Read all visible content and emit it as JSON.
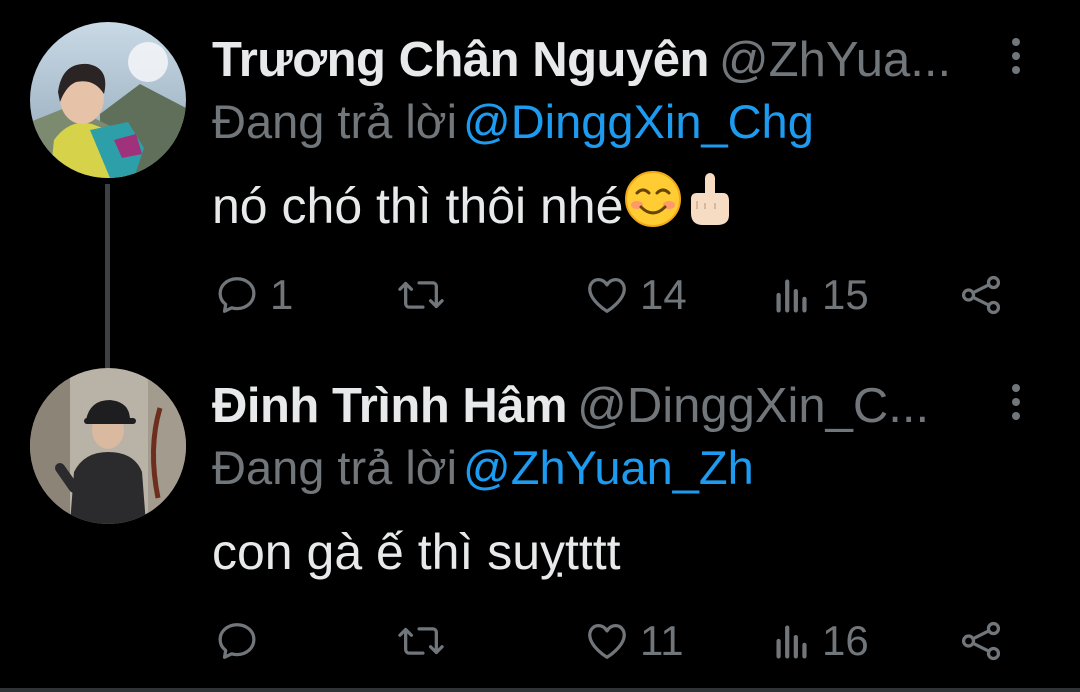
{
  "tweets": [
    {
      "display_name": "Trương Chân Nguyên",
      "handle": "@ZhYua...",
      "replying_prefix": "Đang trả lời",
      "replying_to": "@DinggXin_Chg",
      "text": "nó chó thì thôi nhé",
      "emojis": [
        "smiling-face-icon",
        "middle-finger-icon"
      ],
      "stats": {
        "replies": "1",
        "retweets": "",
        "likes": "14",
        "views": "15"
      }
    },
    {
      "display_name": "Đinh Trình Hâm",
      "handle": "@DinggXin_C...",
      "replying_prefix": "Đang trả lời",
      "replying_to": "@ZhYuan_Zh",
      "text": "con gà ế thì suỵtttt",
      "emojis": [],
      "stats": {
        "replies": "",
        "retweets": "",
        "likes": "11",
        "views": "16"
      }
    }
  ],
  "colors": {
    "background": "#000000",
    "primary_text": "#e7e9ea",
    "secondary_text": "#71767b",
    "accent": "#1d9bf0",
    "thread_line": "#3e4144"
  }
}
